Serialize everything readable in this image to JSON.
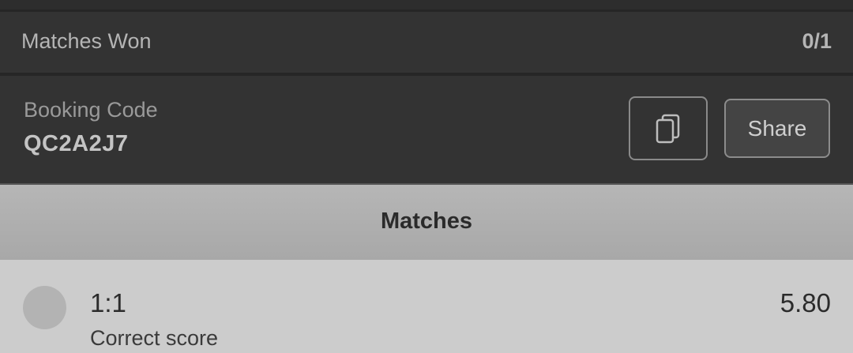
{
  "summary": {
    "matches_won_label": "Matches Won",
    "matches_won_value": "0/1"
  },
  "booking": {
    "label": "Booking Code",
    "code": "QC2A2J7",
    "copy_icon": "copy-icon",
    "share_label": "Share"
  },
  "matches": {
    "header": "Matches",
    "items": [
      {
        "score": "1:1",
        "market": "Correct score",
        "odds": "5.80",
        "status_icon": "status-circle"
      }
    ]
  }
}
